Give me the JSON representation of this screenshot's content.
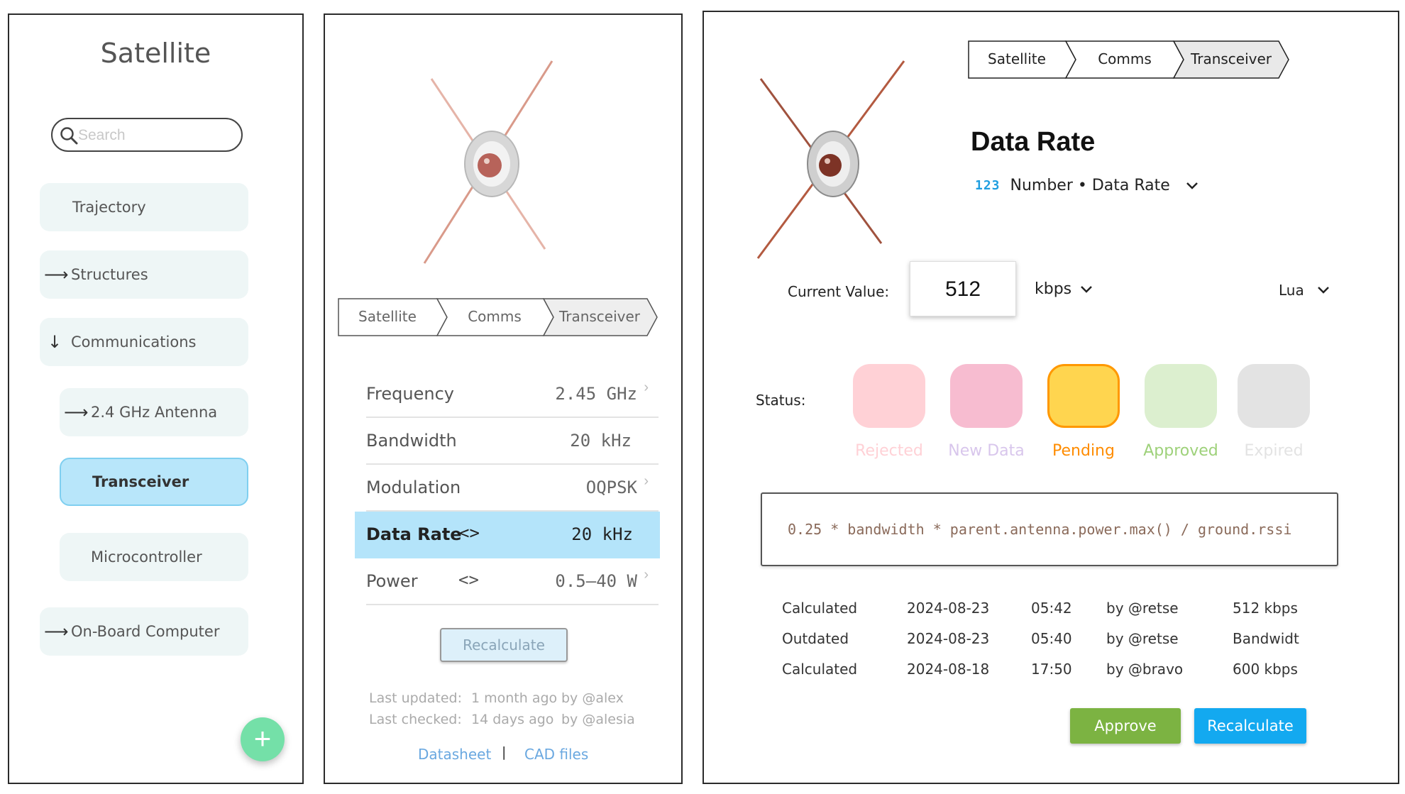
{
  "nav": {
    "title": "Satellite",
    "search_placeholder": "Search",
    "items": [
      {
        "label": "Trajectory",
        "arrow": ""
      },
      {
        "label": "Structures",
        "arrow": "⟶"
      },
      {
        "label": "Communications",
        "arrow": "↓"
      },
      {
        "label": "2.4 GHz Antenna",
        "arrow": "⟶"
      },
      {
        "label": "Transceiver",
        "arrow": ""
      },
      {
        "label": "Microcontroller",
        "arrow": ""
      },
      {
        "label": "On-Board Computer",
        "arrow": "⟶"
      }
    ],
    "add_label": "+"
  },
  "breadcrumb": [
    "Satellite",
    "Comms",
    "Transceiver"
  ],
  "properties": [
    {
      "name": "Frequency",
      "value": "2.45 GHz",
      "chevron": "›",
      "code": ""
    },
    {
      "name": "Bandwidth",
      "value": "20 kHz",
      "chevron": "",
      "code": ""
    },
    {
      "name": "Modulation",
      "value": "OQPSK",
      "chevron": "›",
      "code": ""
    },
    {
      "name": "Data Rate",
      "value": "20 kHz",
      "chevron": "",
      "code": "<>"
    },
    {
      "name": "Power",
      "value": "0.5–40 W",
      "chevron": "›",
      "code": "<>"
    }
  ],
  "detail": {
    "recalculate_label": "Recalculate",
    "last_updated_label": "Last updated:",
    "last_updated_value": "1 month ago",
    "last_updated_by": "by @alex",
    "last_checked_label": "Last checked:",
    "last_checked_value": "14 days ago",
    "last_checked_by": "by @alesia",
    "datasheet_link": "Datasheet",
    "separator": "|",
    "cad_link": "CAD files"
  },
  "editor": {
    "title": "Data Rate",
    "type_badge": "123",
    "type_label": "Number • Data Rate",
    "current_value_label": "Current Value:",
    "current_value": "512",
    "unit": "kbps",
    "language": "Lua",
    "status_label": "Status:",
    "statuses": [
      {
        "label": "Rejected",
        "fill": "#ffd1d6",
        "text": "#ffd1d6"
      },
      {
        "label": "New Data",
        "fill": "#f7bcd0",
        "text": "#d8c6ec"
      },
      {
        "label": "Pending",
        "fill": "#ffd54f",
        "text": "#ff8c00"
      },
      {
        "label": "Approved",
        "fill": "#dcefcf",
        "text": "#9ed17a"
      },
      {
        "label": "Expired",
        "fill": "#e3e3e3",
        "text": "#e3e3e3"
      }
    ],
    "formula": "0.25 * bandwidth * parent.antenna.power.max() / ground.rssi",
    "history": [
      [
        "Calculated",
        "2024-08-23",
        "05:42",
        "by @retse",
        "512 kbps"
      ],
      [
        "Outdated",
        "2024-08-23",
        "05:40",
        "by @retse",
        "Bandwidt"
      ],
      [
        "Calculated",
        "2024-08-18",
        "17:50",
        "by @bravo",
        "600 kbps"
      ]
    ],
    "approve_label": "Approve",
    "recalculate_label": "Recalculate"
  },
  "colors": {
    "selected_bg": "#b4e4fa",
    "approve": "#7cb342",
    "recalculate": "#13a9f0",
    "pending_border": "#ff9800",
    "fab": "#74e0a8"
  }
}
